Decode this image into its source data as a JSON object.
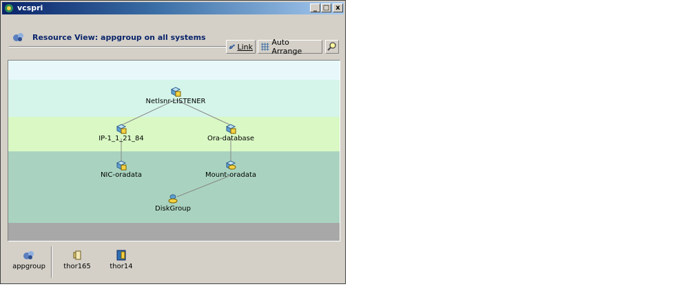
{
  "window": {
    "title": "vcspri",
    "minimize": "_",
    "maximize": "□",
    "close": "x"
  },
  "header": {
    "title": "Resource View: appgroup on all systems"
  },
  "toolbar": {
    "link_label": "Link",
    "auto_arrange_label": "Auto Arrange"
  },
  "graph": {
    "nodes": [
      {
        "id": "listener",
        "label": "Netlsnr-LISTENER"
      },
      {
        "id": "ip",
        "label": "IP-1_1_21_84"
      },
      {
        "id": "ora",
        "label": "Ora-database"
      },
      {
        "id": "nic",
        "label": "NIC-oradata"
      },
      {
        "id": "mount",
        "label": "Mount-oradata"
      },
      {
        "id": "disk",
        "label": "DiskGroup"
      }
    ],
    "edges": [
      [
        "listener",
        "ip"
      ],
      [
        "listener",
        "ora"
      ],
      [
        "ip",
        "nic"
      ],
      [
        "ora",
        "mount"
      ],
      [
        "mount",
        "disk"
      ]
    ]
  },
  "bottom": {
    "group_label": "appgroup",
    "systems": [
      "thor165",
      "thor14"
    ]
  },
  "colors": {
    "band_top": "#e8f8fa",
    "band_light": "#d5f5ea",
    "band_green": "#d9f8c4",
    "band_teal": "#a9d3c0",
    "band_gray": "#a8a8a8",
    "title_blue": "#0a246a"
  }
}
